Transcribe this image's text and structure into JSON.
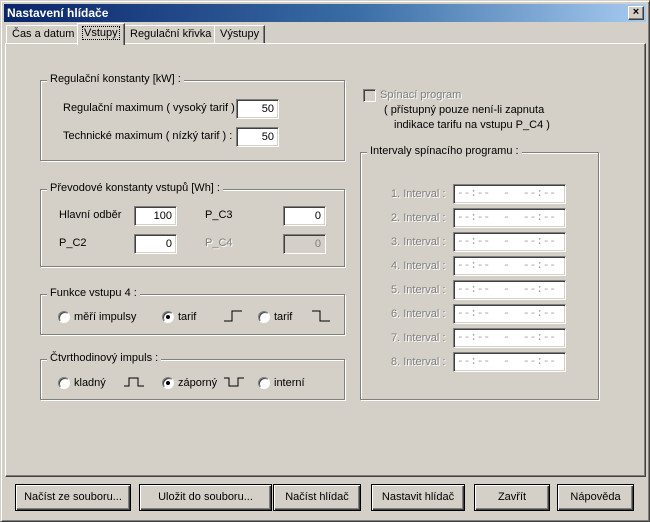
{
  "window": {
    "title": "Nastavení hlídače",
    "close_glyph": "×"
  },
  "tabs": [
    {
      "label": "Čas a datum"
    },
    {
      "label": "Vstupy"
    },
    {
      "label": "Regulační křivka"
    },
    {
      "label": "Výstupy"
    }
  ],
  "active_tab": "Vstupy",
  "regulacni": {
    "title": "Regulační konstanty [kW] :",
    "max_label": "Regulační maximum ( vysoký tarif ) :",
    "max_value": "50",
    "tech_label": "Technické maximum ( nízký tarif ) :",
    "tech_value": "50"
  },
  "prevodove": {
    "title": "Převodové konstanty vstupů [Wh] :",
    "hlavni_label": "Hlavní odběr",
    "hlavni_value": "100",
    "pc3_label": "P_C3",
    "pc3_value": "0",
    "pc2_label": "P_C2",
    "pc2_value": "0",
    "pc4_label": "P_C4",
    "pc4_value": "0"
  },
  "funkce": {
    "title": "Funkce vstupu 4 :",
    "options": [
      "měří impulsy",
      "tarif",
      "tarif"
    ],
    "selected": "tarif (rising)"
  },
  "ctvrthod": {
    "title": "Čtvrthodinový impuls :",
    "options": [
      "kladný",
      "záporný",
      "interní"
    ],
    "selected": "záporný"
  },
  "spinaci": {
    "checkbox_label": "Spínací program",
    "checked": false,
    "note_line1": "( přístupný pouze není-li zapnuta",
    "note_line2": "indikace tarifu na vstupu P_C4 )",
    "intervals_title": "Intervaly spínacího programu :",
    "intervals": [
      {
        "label": "1. Interval :",
        "value": "--:--  -  --:--"
      },
      {
        "label": "2. Interval :",
        "value": "--:--  -  --:--"
      },
      {
        "label": "3. Interval :",
        "value": "--:--  -  --:--"
      },
      {
        "label": "4. Interval :",
        "value": "--:--  -  --:--"
      },
      {
        "label": "5. Interval :",
        "value": "--:--  -  --:--"
      },
      {
        "label": "6. Interval :",
        "value": "--:--  -  --:--"
      },
      {
        "label": "7. Interval :",
        "value": "--:--  -  --:--"
      },
      {
        "label": "8. Interval :",
        "value": "--:--  -  --:--"
      }
    ]
  },
  "buttons": {
    "load_file": "Načíst ze souboru...",
    "save_file": "Uložit do souboru...",
    "read_device": "Načíst hlídač",
    "set_device": "Nastavit hlídač",
    "close": "Zavřít",
    "help": "Nápověda"
  }
}
